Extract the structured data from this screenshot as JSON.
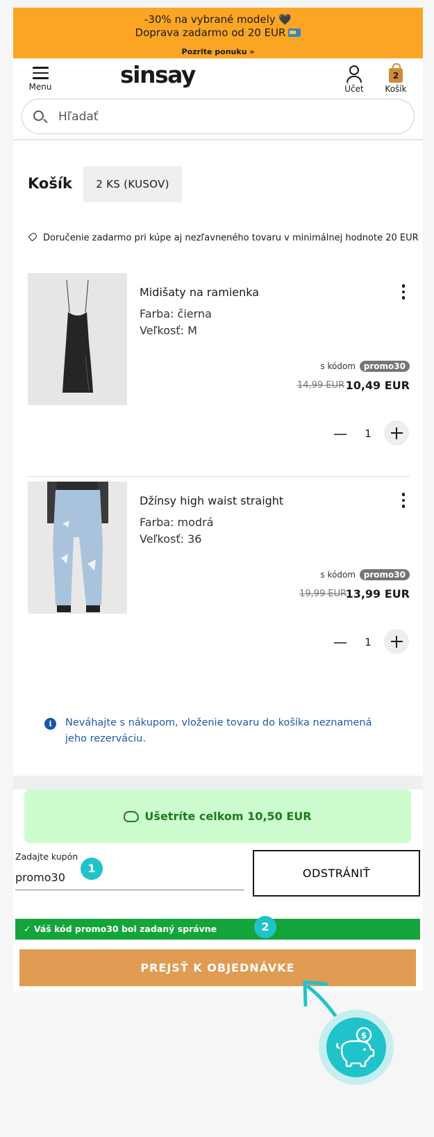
{
  "banner": {
    "line1": "-30% na vybrané modely 🖤",
    "line2": "Doprava zadarmo od 20 EUR",
    "link": "Pozrite ponuku »"
  },
  "header": {
    "menu_label": "Menu",
    "logo": "sinsay",
    "account_label": "Účet",
    "cart_label": "Košík",
    "cart_count": "2",
    "search_placeholder": "Hľadať"
  },
  "cart": {
    "title": "Košík",
    "count": "2 KS (KUSOV)",
    "free_delivery_notice": "Doručenie zadarmo pri kúpe aj nezľavneného tovaru v minimálnej hodnote 20 EUR",
    "items": [
      {
        "name": "Midišaty na ramienka",
        "color": "Farba: čierna",
        "size": "Veľkosť: M",
        "code_prefix": "s kódom",
        "code": "promo30",
        "old_price": "14,99 EUR",
        "new_price": "10,49 EUR",
        "quantity": "1"
      },
      {
        "name": "Džínsy high waist straight",
        "color": "Farba: modrá",
        "size": "Veľkosť: 36",
        "code_prefix": "s kódom",
        "code": "promo30",
        "old_price": "19,99 EUR",
        "new_price": "13,99 EUR",
        "quantity": "1"
      }
    ]
  },
  "info": {
    "text": "Neváhajte s nákupom, vloženie tovaru do košíka neznamená jeho rezerváciu."
  },
  "summary": {
    "savings": "Ušetríte celkom 10,50 EUR",
    "coupon_label": "Zadajte kupón",
    "coupon_value": "promo30",
    "remove_label": "ODSTRÁNIŤ",
    "success_message": "✓ Váš kód promo30 bol zadaný správne",
    "checkout_label": "PREJSŤ K OBJEDNÁVKE"
  },
  "annotations": {
    "step1": "1",
    "step2": "2"
  },
  "colors": {
    "banner": "#fba525",
    "checkout": "#df9c52",
    "success": "#14a53a",
    "savings_bg": "#cdfccf",
    "annotation": "#1fc3c9"
  }
}
